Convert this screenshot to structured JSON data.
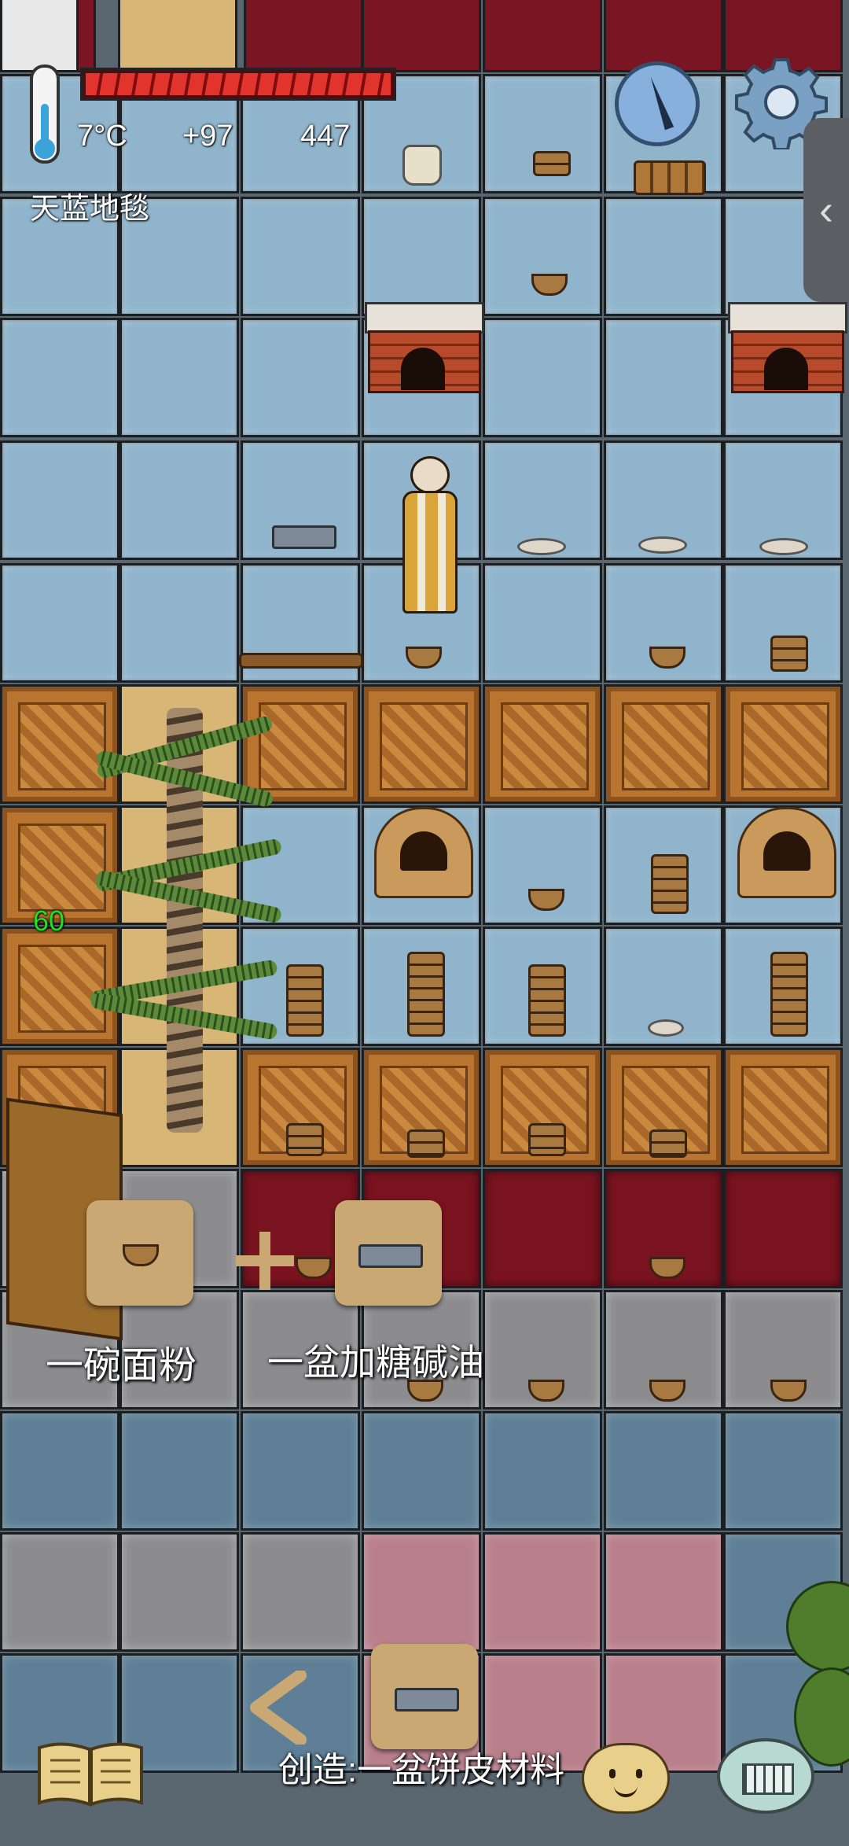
{
  "hud": {
    "temperature": "7°C",
    "food_bonus": "+97",
    "yum_total": "447",
    "tile_name": "天蓝地毯",
    "food_level_fraction": 1.0
  },
  "world_labels": {
    "age_marker": "60"
  },
  "recipe_hint": {
    "ingredient_1": "一碗面粉",
    "ingredient_2": "一盆加糖碱油"
  },
  "craft": {
    "label": "创造:一盆饼皮材料"
  },
  "icons": {
    "thermometer": "thermometer-icon",
    "compass": "compass-icon",
    "settings": "gear-icon",
    "side_panel": "chevron-left-icon",
    "book": "open-book-icon",
    "back": "chevron-left-icon",
    "emote": "smiley-face-icon",
    "keyboard": "keyboard-icon"
  },
  "colors": {
    "food_bar": "#e0342d",
    "temp_fill": "#3ba3d9",
    "age_text": "#22dd22",
    "slot_bg": "#caa874"
  }
}
